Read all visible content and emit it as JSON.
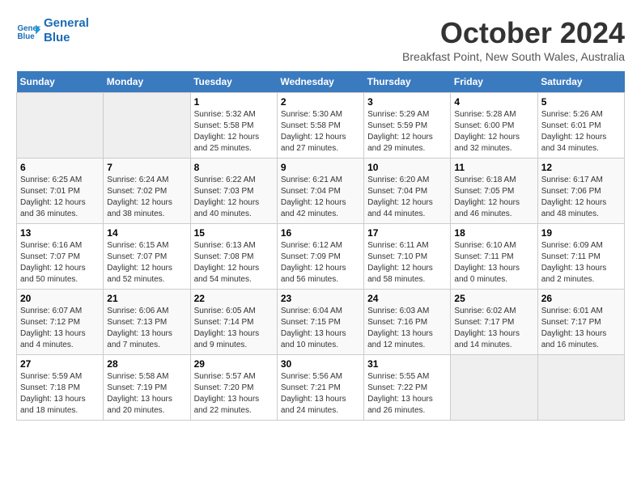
{
  "header": {
    "logo_line1": "General",
    "logo_line2": "Blue",
    "month": "October 2024",
    "location": "Breakfast Point, New South Wales, Australia"
  },
  "days_of_week": [
    "Sunday",
    "Monday",
    "Tuesday",
    "Wednesday",
    "Thursday",
    "Friday",
    "Saturday"
  ],
  "weeks": [
    [
      {
        "day": null
      },
      {
        "day": null
      },
      {
        "day": 1,
        "sunrise": "5:32 AM",
        "sunset": "5:58 PM",
        "daylight": "12 hours and 25 minutes."
      },
      {
        "day": 2,
        "sunrise": "5:30 AM",
        "sunset": "5:58 PM",
        "daylight": "12 hours and 27 minutes."
      },
      {
        "day": 3,
        "sunrise": "5:29 AM",
        "sunset": "5:59 PM",
        "daylight": "12 hours and 29 minutes."
      },
      {
        "day": 4,
        "sunrise": "5:28 AM",
        "sunset": "6:00 PM",
        "daylight": "12 hours and 32 minutes."
      },
      {
        "day": 5,
        "sunrise": "5:26 AM",
        "sunset": "6:01 PM",
        "daylight": "12 hours and 34 minutes."
      }
    ],
    [
      {
        "day": 6,
        "sunrise": "6:25 AM",
        "sunset": "7:01 PM",
        "daylight": "12 hours and 36 minutes."
      },
      {
        "day": 7,
        "sunrise": "6:24 AM",
        "sunset": "7:02 PM",
        "daylight": "12 hours and 38 minutes."
      },
      {
        "day": 8,
        "sunrise": "6:22 AM",
        "sunset": "7:03 PM",
        "daylight": "12 hours and 40 minutes."
      },
      {
        "day": 9,
        "sunrise": "6:21 AM",
        "sunset": "7:04 PM",
        "daylight": "12 hours and 42 minutes."
      },
      {
        "day": 10,
        "sunrise": "6:20 AM",
        "sunset": "7:04 PM",
        "daylight": "12 hours and 44 minutes."
      },
      {
        "day": 11,
        "sunrise": "6:18 AM",
        "sunset": "7:05 PM",
        "daylight": "12 hours and 46 minutes."
      },
      {
        "day": 12,
        "sunrise": "6:17 AM",
        "sunset": "7:06 PM",
        "daylight": "12 hours and 48 minutes."
      }
    ],
    [
      {
        "day": 13,
        "sunrise": "6:16 AM",
        "sunset": "7:07 PM",
        "daylight": "12 hours and 50 minutes."
      },
      {
        "day": 14,
        "sunrise": "6:15 AM",
        "sunset": "7:07 PM",
        "daylight": "12 hours and 52 minutes."
      },
      {
        "day": 15,
        "sunrise": "6:13 AM",
        "sunset": "7:08 PM",
        "daylight": "12 hours and 54 minutes."
      },
      {
        "day": 16,
        "sunrise": "6:12 AM",
        "sunset": "7:09 PM",
        "daylight": "12 hours and 56 minutes."
      },
      {
        "day": 17,
        "sunrise": "6:11 AM",
        "sunset": "7:10 PM",
        "daylight": "12 hours and 58 minutes."
      },
      {
        "day": 18,
        "sunrise": "6:10 AM",
        "sunset": "7:11 PM",
        "daylight": "13 hours and 0 minutes."
      },
      {
        "day": 19,
        "sunrise": "6:09 AM",
        "sunset": "7:11 PM",
        "daylight": "13 hours and 2 minutes."
      }
    ],
    [
      {
        "day": 20,
        "sunrise": "6:07 AM",
        "sunset": "7:12 PM",
        "daylight": "13 hours and 4 minutes."
      },
      {
        "day": 21,
        "sunrise": "6:06 AM",
        "sunset": "7:13 PM",
        "daylight": "13 hours and 7 minutes."
      },
      {
        "day": 22,
        "sunrise": "6:05 AM",
        "sunset": "7:14 PM",
        "daylight": "13 hours and 9 minutes."
      },
      {
        "day": 23,
        "sunrise": "6:04 AM",
        "sunset": "7:15 PM",
        "daylight": "13 hours and 10 minutes."
      },
      {
        "day": 24,
        "sunrise": "6:03 AM",
        "sunset": "7:16 PM",
        "daylight": "13 hours and 12 minutes."
      },
      {
        "day": 25,
        "sunrise": "6:02 AM",
        "sunset": "7:17 PM",
        "daylight": "13 hours and 14 minutes."
      },
      {
        "day": 26,
        "sunrise": "6:01 AM",
        "sunset": "7:17 PM",
        "daylight": "13 hours and 16 minutes."
      }
    ],
    [
      {
        "day": 27,
        "sunrise": "5:59 AM",
        "sunset": "7:18 PM",
        "daylight": "13 hours and 18 minutes."
      },
      {
        "day": 28,
        "sunrise": "5:58 AM",
        "sunset": "7:19 PM",
        "daylight": "13 hours and 20 minutes."
      },
      {
        "day": 29,
        "sunrise": "5:57 AM",
        "sunset": "7:20 PM",
        "daylight": "13 hours and 22 minutes."
      },
      {
        "day": 30,
        "sunrise": "5:56 AM",
        "sunset": "7:21 PM",
        "daylight": "13 hours and 24 minutes."
      },
      {
        "day": 31,
        "sunrise": "5:55 AM",
        "sunset": "7:22 PM",
        "daylight": "13 hours and 26 minutes."
      },
      {
        "day": null
      },
      {
        "day": null
      }
    ]
  ],
  "labels": {
    "sunrise_prefix": "Sunrise: ",
    "sunset_prefix": "Sunset: ",
    "daylight_prefix": "Daylight: "
  }
}
